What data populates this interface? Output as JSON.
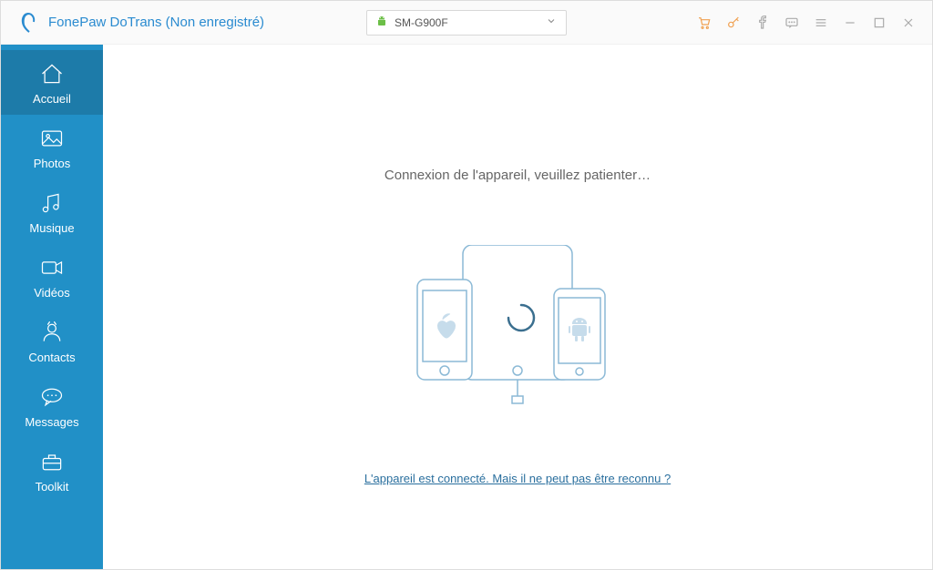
{
  "header": {
    "app_title": "FonePaw DoTrans (Non enregistré)"
  },
  "device": {
    "name": "SM-G900F",
    "platform": "android"
  },
  "sidebar": {
    "items": [
      {
        "id": "home",
        "label": "Accueil",
        "icon": "home-icon",
        "active": true
      },
      {
        "id": "photos",
        "label": "Photos",
        "icon": "photos-icon",
        "active": false
      },
      {
        "id": "music",
        "label": "Musique",
        "icon": "music-icon",
        "active": false
      },
      {
        "id": "videos",
        "label": "Vidéos",
        "icon": "video-icon",
        "active": false
      },
      {
        "id": "contacts",
        "label": "Contacts",
        "icon": "contacts-icon",
        "active": false
      },
      {
        "id": "messages",
        "label": "Messages",
        "icon": "messages-icon",
        "active": false
      },
      {
        "id": "toolkit",
        "label": "Toolkit",
        "icon": "toolkit-icon",
        "active": false
      }
    ]
  },
  "main": {
    "status_text": "Connexion de l'appareil, veuillez patienter…",
    "help_link": "L'appareil est connecté. Mais il ne peut pas être reconnu ?"
  },
  "toolbar_icons": {
    "cart": "cart-icon",
    "key": "key-icon",
    "facebook": "facebook-icon",
    "feedback": "feedback-icon",
    "menu": "menu-icon",
    "minimize": "minimize-icon",
    "maximize": "maximize-icon",
    "close": "close-icon"
  },
  "colors": {
    "accent": "#2a8bd0",
    "sidebar": "#2190c7",
    "sidebar_active": "#1d7ba9",
    "link": "#2a6f9e",
    "illustration": "#8bb9d6",
    "orange": "#f0a050"
  }
}
